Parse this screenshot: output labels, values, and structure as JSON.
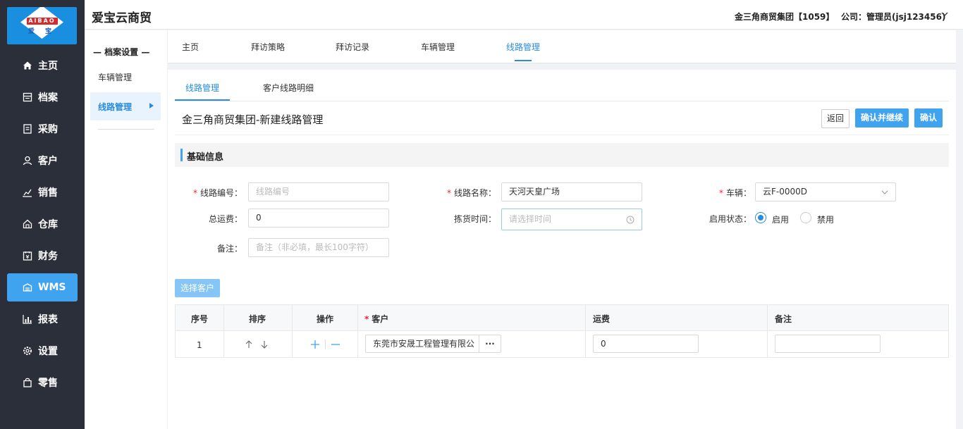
{
  "logo": {
    "top_text": "AIBAO",
    "bottom_text": "爱 宝"
  },
  "sidebar": {
    "items": [
      {
        "label": "主页",
        "icon": "home-icon"
      },
      {
        "label": "档案",
        "icon": "archive-icon"
      },
      {
        "label": "采购",
        "icon": "purchase-icon"
      },
      {
        "label": "客户",
        "icon": "customer-icon"
      },
      {
        "label": "销售",
        "icon": "sales-icon"
      },
      {
        "label": "仓库",
        "icon": "warehouse-icon"
      },
      {
        "label": "财务",
        "icon": "finance-icon"
      },
      {
        "label": "WMS",
        "icon": "wms-icon",
        "active": true
      },
      {
        "label": "报表",
        "icon": "report-icon"
      },
      {
        "label": "设置",
        "icon": "settings-icon"
      },
      {
        "label": "零售",
        "icon": "retail-icon"
      }
    ]
  },
  "header": {
    "brand": "爱宝云商贸",
    "company": "金三角商贸集团【1059】",
    "user": "公司：管理员(jsj123456)"
  },
  "subnav": {
    "heading": "— 档案设置 —",
    "items": [
      {
        "label": "车辆管理"
      },
      {
        "label": "线路管理",
        "active": true
      }
    ]
  },
  "top_tabs": [
    {
      "label": "主页"
    },
    {
      "label": "拜访策略"
    },
    {
      "label": "拜访记录"
    },
    {
      "label": "车辆管理"
    },
    {
      "label": "线路管理",
      "active": true
    }
  ],
  "panel_tabs": [
    {
      "label": "线路管理",
      "active": true
    },
    {
      "label": "客户线路明细"
    }
  ],
  "form": {
    "title": "金三角商贸集团-新建线路管理",
    "buttons": {
      "back": "返回",
      "confirm_continue": "确认并继续",
      "confirm": "确认"
    },
    "section_title": "基础信息",
    "fields": {
      "route_code": {
        "label": "线路编号：",
        "required_mark": "*",
        "placeholder": "线路编号",
        "value": ""
      },
      "route_name": {
        "label": "线路名称：",
        "required_mark": "*",
        "value": "天河天皇广场"
      },
      "vehicle": {
        "label": "车辆：",
        "required_mark": "*",
        "value": "云F-0000D"
      },
      "total_freight": {
        "label": "总运费：",
        "value": "0"
      },
      "pick_time": {
        "label": "拣货时间：",
        "placeholder": "请选择时间",
        "value": ""
      },
      "status": {
        "label": "启用状态：",
        "options": [
          "启用",
          "禁用"
        ],
        "selected": "启用"
      },
      "remark": {
        "label": "备注：",
        "placeholder": "备注（非必填，最长100字符）",
        "value": ""
      }
    },
    "select_customer_button": "选择客户"
  },
  "table": {
    "columns": [
      "序号",
      "排序",
      "操作",
      "客户",
      "运费",
      "备注"
    ],
    "customer_required_mark": "*",
    "rows": [
      {
        "index": "1",
        "customer": "东莞市安晟工程管理有限公",
        "more": "···",
        "freight": "0",
        "remark": ""
      }
    ]
  },
  "colors": {
    "accent": "#2a8ce0",
    "sidebar_bg": "#2b2f3a",
    "active_nav": "#3fa3f0",
    "required": "#e23"
  }
}
